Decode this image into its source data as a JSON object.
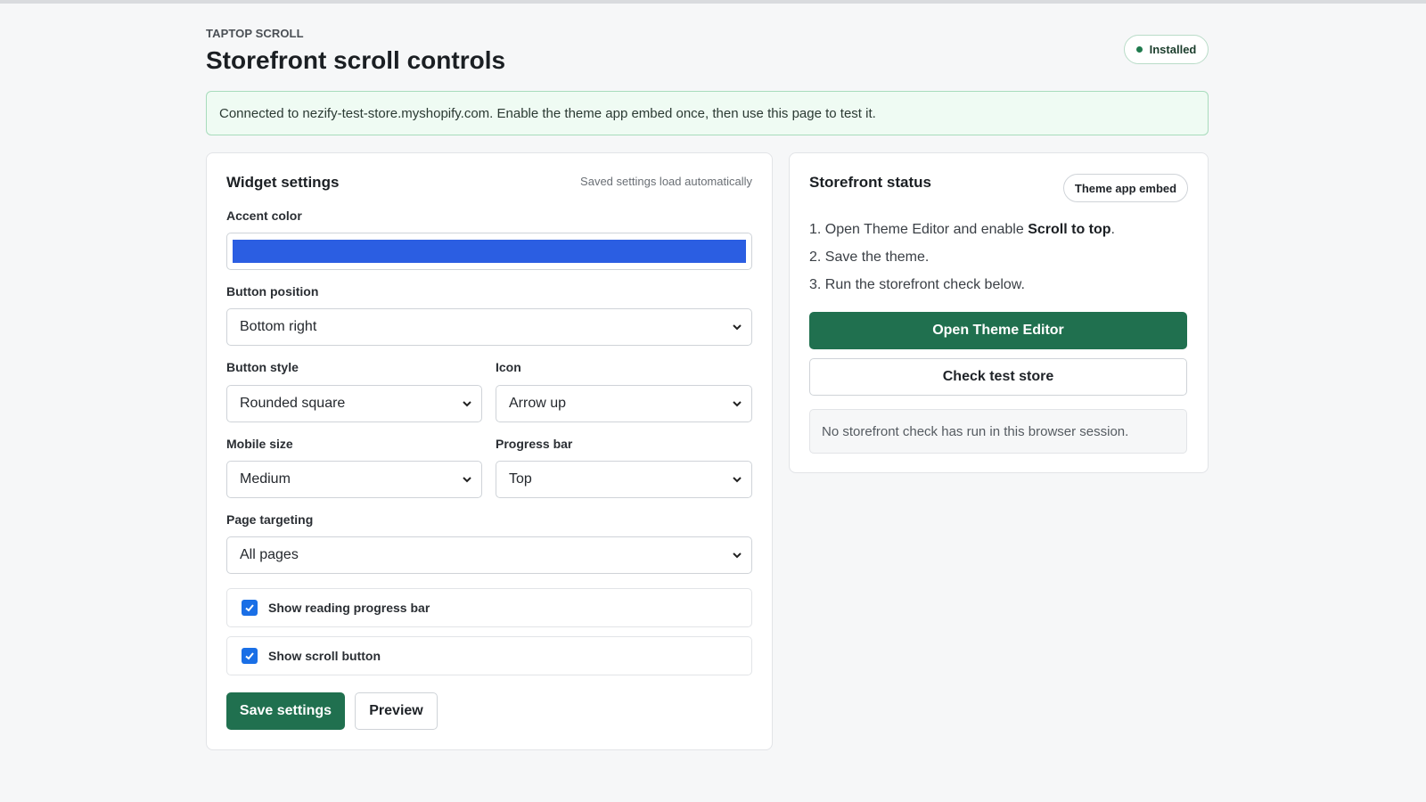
{
  "header": {
    "eyebrow": "TAPTOP SCROLL",
    "title": "Storefront scroll controls",
    "status": "Installed"
  },
  "banner": {
    "text": "Connected to nezify-test-store.myshopify.com. Enable the theme app embed once, then use this page to test it."
  },
  "widget": {
    "title": "Widget settings",
    "hint": "Saved settings load automatically",
    "accent_label": "Accent color",
    "accent_color": "#2b5ee2",
    "position_label": "Button position",
    "position_value": "Bottom right",
    "style_label": "Button style",
    "style_value": "Rounded square",
    "icon_label": "Icon",
    "icon_value": "Arrow up",
    "mobile_label": "Mobile size",
    "mobile_value": "Medium",
    "progress_label": "Progress bar",
    "progress_value": "Top",
    "targeting_label": "Page targeting",
    "targeting_value": "All pages",
    "check_progress_label": "Show reading progress bar",
    "check_progress_checked": true,
    "check_scroll_label": "Show scroll button",
    "check_scroll_checked": true,
    "save_label": "Save settings",
    "preview_label": "Preview"
  },
  "status_card": {
    "title": "Storefront status",
    "chip": "Theme app embed",
    "step1_prefix": "1. Open Theme Editor and enable ",
    "step1_bold": "Scroll to top",
    "step1_suffix": ".",
    "step2": "2. Save the theme.",
    "step3": "3. Run the storefront check below.",
    "open_editor_label": "Open Theme Editor",
    "check_store_label": "Check test store",
    "notice": "No storefront check has run in this browser session."
  },
  "colors": {
    "primary_button": "#20704f",
    "banner_bg": "#effbf3",
    "checkbox": "#1a6fe6"
  }
}
